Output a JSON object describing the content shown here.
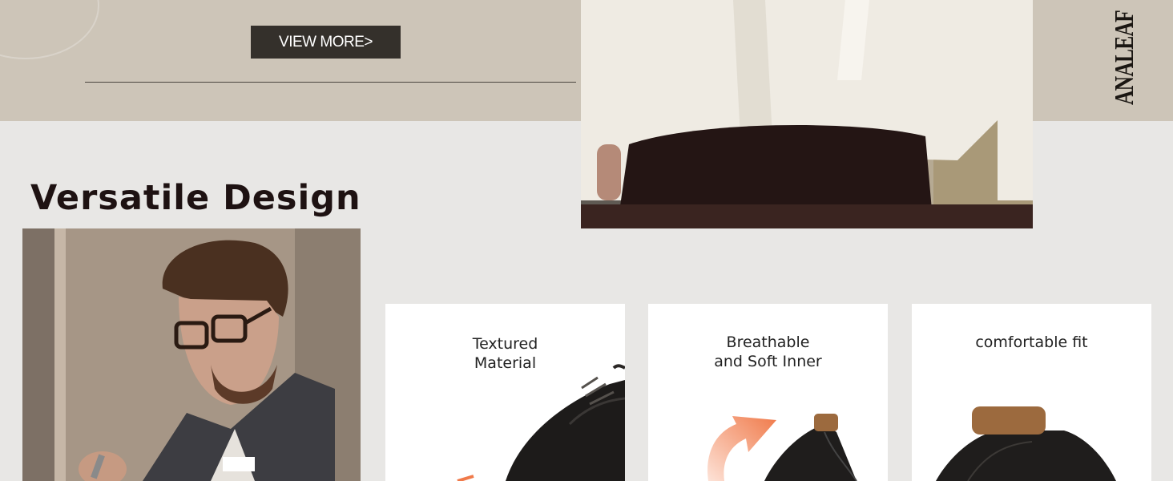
{
  "promo": {
    "view_more_label": "VIEW MORE>",
    "brand": "ANALEAF"
  },
  "section": {
    "title": "Versatile Design"
  },
  "features": [
    {
      "line1": "Textured",
      "line2": "Material",
      "icon": "shoe-texture-closeup"
    },
    {
      "line1": "Breathable",
      "line2": "and Soft Inner",
      "icon": "shoe-heel-with-arrow"
    },
    {
      "line1": "comfortable fit",
      "line2": "",
      "icon": "shoe-top-view"
    }
  ],
  "colors": {
    "top_band": "#cdc5b8",
    "page_bg": "#e8e7e5",
    "button_bg": "#34302b",
    "accent_arrow": "#f07a4a"
  }
}
